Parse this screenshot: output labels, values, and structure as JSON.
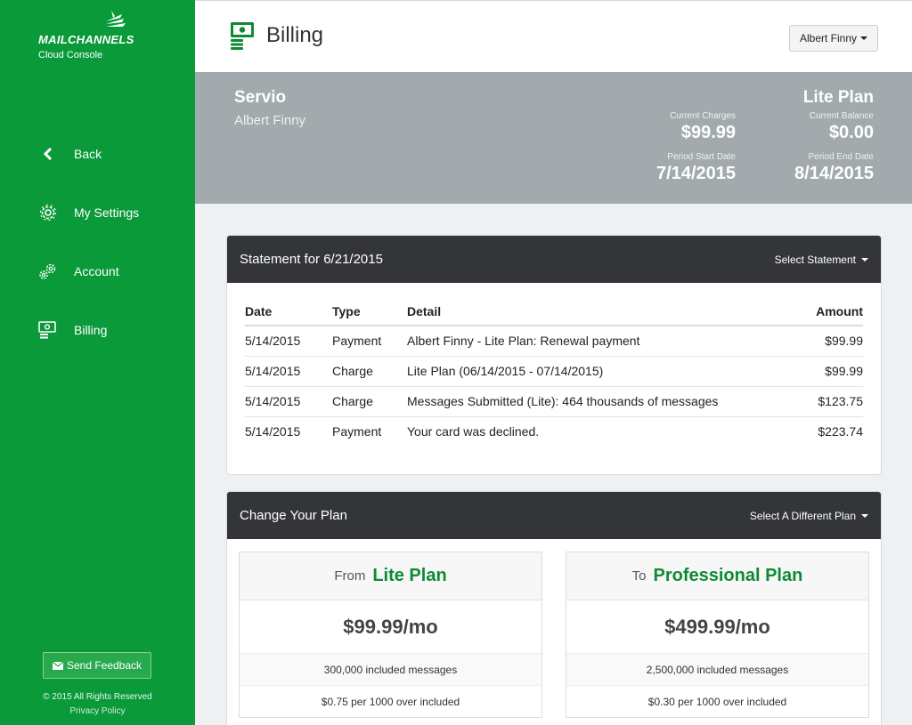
{
  "brand": {
    "name": "MAILCHANNELS",
    "subtitle": "Cloud Console",
    "color": "#0a9a3a"
  },
  "sidebar": {
    "items": [
      {
        "label": "Back",
        "icon": "chevron-left-icon"
      },
      {
        "label": "My Settings",
        "icon": "gear-icon"
      },
      {
        "label": "Account",
        "icon": "gears-icon"
      },
      {
        "label": "Billing",
        "icon": "money-icon"
      }
    ],
    "feedback_label": "Send Feedback",
    "copyright": "© 2015 All Rights Reserved",
    "privacy_label": "Privacy Policy"
  },
  "header": {
    "title": "Billing",
    "user_name": "Albert Finny"
  },
  "summary": {
    "company": "Servio",
    "owner": "Albert Finny",
    "plan": "Lite Plan",
    "current_charges_label": "Current Charges",
    "current_charges": "$99.99",
    "current_balance_label": "Current Balance",
    "current_balance": "$0.00",
    "period_start_label": "Period Start Date",
    "period_start": "7/14/2015",
    "period_end_label": "Period End Date",
    "period_end": "8/14/2015"
  },
  "statement": {
    "title": "Statement for 6/21/2015",
    "select_label": "Select Statement",
    "columns": [
      "Date",
      "Type",
      "Detail",
      "Amount"
    ],
    "rows": [
      {
        "date": "5/14/2015",
        "type": "Payment",
        "detail": "Albert Finny - Lite Plan: Renewal payment",
        "amount": "$99.99"
      },
      {
        "date": "5/14/2015",
        "type": "Charge",
        "detail": "Lite Plan (06/14/2015 - 07/14/2015)",
        "amount": "$99.99"
      },
      {
        "date": "5/14/2015",
        "type": "Charge",
        "detail": "Messages Submitted (Lite): 464 thousands of messages",
        "amount": "$123.75"
      },
      {
        "date": "5/14/2015",
        "type": "Payment",
        "detail": "Your card was declined.",
        "amount": "$223.74"
      }
    ]
  },
  "change_plan": {
    "title": "Change Your Plan",
    "select_label": "Select A Different Plan",
    "from": {
      "direction": "From",
      "name": "Lite Plan",
      "price": "$99.99/mo",
      "included": "300,000 included messages",
      "overage": "$0.75 per 1000 over included"
    },
    "to": {
      "direction": "To",
      "name": "Professional Plan",
      "price": "$499.99/mo",
      "included": "2,500,000 included messages",
      "overage": "$0.30 per 1000 over included"
    }
  }
}
